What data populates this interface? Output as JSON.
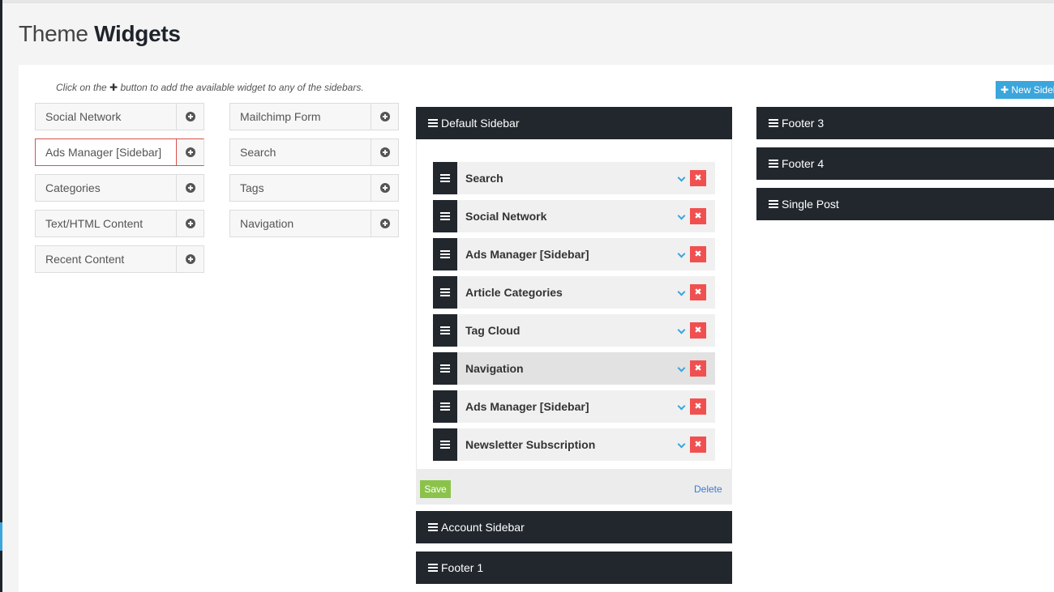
{
  "page": {
    "title_light": "Theme",
    "title_bold": "Widgets"
  },
  "hint": {
    "before": "Click on the",
    "plus": "✚",
    "after": "button to add the available widget to any of the sidebars."
  },
  "new_sidebar_button": "✚ New Sidebar",
  "available_widgets": {
    "column_1": [
      "Social Network",
      "Ads Manager [Sidebar]",
      "Categories",
      "Text/HTML Content",
      "Recent Content"
    ],
    "column_2": [
      "Mailchimp Form",
      "Search",
      "Tags",
      "Navigation"
    ]
  },
  "default_sidebar": {
    "title": "Default Sidebar",
    "widgets": [
      "Search",
      "Social Network",
      "Ads Manager [Sidebar]",
      "Article Categories",
      "Tag Cloud",
      "Navigation",
      "Ads Manager [Sidebar]",
      "Newsletter Subscription"
    ],
    "remove_glyph": "✖",
    "save_label": "Save",
    "delete_label": "Delete"
  },
  "sidebars_collapsed": {
    "account": "Account Sidebar",
    "footer_1": "Footer 1",
    "footer_3": "Footer 3",
    "footer_4": "Footer 4",
    "single_post": "Single Post"
  },
  "colors": {
    "header_dark": "#22272e",
    "accent_blue": "#3aa6dc",
    "remove_red": "#f05050",
    "save_green": "#8bc34a"
  }
}
